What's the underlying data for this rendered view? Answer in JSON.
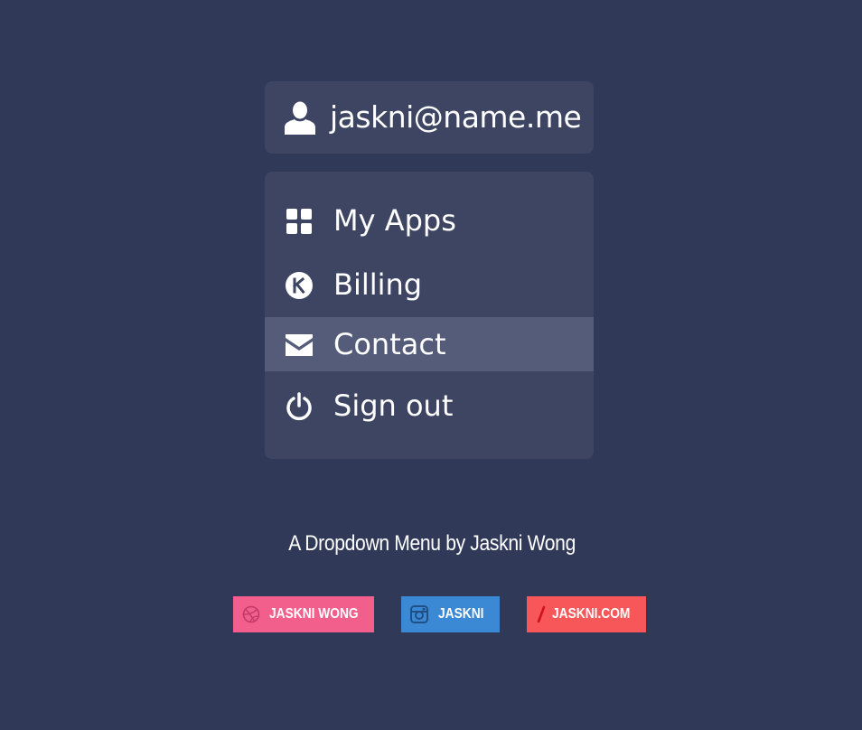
{
  "user": {
    "email": "jaskni@name.me",
    "icon": "user-icon"
  },
  "menu": {
    "items": [
      {
        "label": "My Apps",
        "icon": "grid-icon",
        "active": false
      },
      {
        "label": "Billing",
        "icon": "k-circle-icon",
        "active": false
      },
      {
        "label": "Contact",
        "icon": "envelope-icon",
        "active": true
      },
      {
        "label": "Sign out",
        "icon": "power-icon",
        "active": false
      }
    ]
  },
  "footer": {
    "credit": "A Dropdown Menu by Jaskni Wong",
    "links": [
      {
        "label": "JASKNI WONG",
        "icon": "dribbble-icon",
        "color": "#f35f8c"
      },
      {
        "label": "JASKNI",
        "icon": "instagram-icon",
        "color": "#3b89d4"
      },
      {
        "label": "JASKNI.COM",
        "icon": "slash-icon",
        "color": "#f8575a"
      }
    ]
  },
  "colors": {
    "background": "#303957",
    "panel": "#3d4563",
    "highlight": "#545c79"
  }
}
